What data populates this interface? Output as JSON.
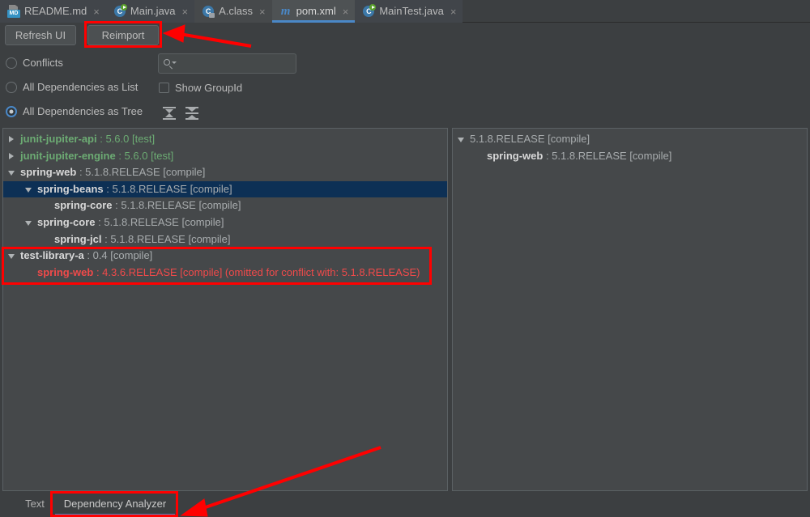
{
  "editor_tabs": [
    {
      "label": "README.md",
      "icon": "markdown-file-icon",
      "active": false,
      "close": "×"
    },
    {
      "label": "Main.java",
      "icon": "java-class-run-icon",
      "active": false,
      "close": "×"
    },
    {
      "label": "A.class",
      "icon": "java-compiled-class-icon",
      "active": false,
      "close": "×"
    },
    {
      "label": "pom.xml",
      "icon": "maven-file-icon",
      "active": true,
      "close": "×"
    },
    {
      "label": "MainTest.java",
      "icon": "java-test-class-icon",
      "active": false,
      "close": "×"
    }
  ],
  "toolbar": {
    "refresh_label": "Refresh UI",
    "reimport_label": "Reimport"
  },
  "options": {
    "conflicts_label": "Conflicts",
    "all_as_list_label": "All Dependencies as List",
    "all_as_tree_label": "All Dependencies as Tree",
    "show_groupid_label": "Show GroupId",
    "selected": "All Dependencies as Tree",
    "show_groupid_checked": false,
    "expand_all_icon": "expand-all-icon",
    "collapse_all_icon": "collapse-all-icon"
  },
  "search": {
    "value": "",
    "placeholder": "",
    "icon": "search-icon"
  },
  "left_tree": {
    "rows": [
      {
        "indent": 0,
        "toggle": "right",
        "name": "junit-jupiter-api",
        "sep": " : ",
        "version": "5.6.0",
        "scope": " [test]",
        "style": "test"
      },
      {
        "indent": 0,
        "toggle": "right",
        "name": "junit-jupiter-engine",
        "sep": " : ",
        "version": "5.6.0",
        "scope": " [test]",
        "style": "test"
      },
      {
        "indent": 0,
        "toggle": "down",
        "name": "spring-web",
        "sep": " : ",
        "version": "5.1.8.RELEASE",
        "scope": " [compile]",
        "style": "normal"
      },
      {
        "indent": 1,
        "toggle": "down",
        "name": "spring-beans",
        "sep": " : ",
        "version": "5.1.8.RELEASE",
        "scope": " [compile]",
        "style": "normal",
        "selected": true
      },
      {
        "indent": 2,
        "toggle": "none",
        "name": "spring-core",
        "sep": " : ",
        "version": "5.1.8.RELEASE",
        "scope": " [compile]",
        "style": "normal"
      },
      {
        "indent": 1,
        "toggle": "down",
        "name": "spring-core",
        "sep": " : ",
        "version": "5.1.8.RELEASE",
        "scope": " [compile]",
        "style": "normal"
      },
      {
        "indent": 2,
        "toggle": "none",
        "name": "spring-jcl",
        "sep": " : ",
        "version": "5.1.8.RELEASE",
        "scope": " [compile]",
        "style": "normal"
      },
      {
        "indent": 0,
        "toggle": "down",
        "name": "test-library-a",
        "sep": " : ",
        "version": "0.4",
        "scope": " [compile]",
        "style": "normal"
      },
      {
        "indent": 1,
        "toggle": "none",
        "name": "spring-web",
        "sep": " : ",
        "version": "4.3.6.RELEASE",
        "scope": " [compile] (omitted for conflict with: 5.1.8.RELEASE)",
        "style": "conflict"
      }
    ]
  },
  "right_tree": {
    "rows": [
      {
        "indent": 0,
        "toggle": "down",
        "name": "",
        "sep": "",
        "version": "5.1.8.RELEASE",
        "scope": " [compile]",
        "style": "normal"
      },
      {
        "indent": 1,
        "toggle": "none",
        "name": "spring-web",
        "sep": " : ",
        "version": "5.1.8.RELEASE",
        "scope": " [compile]",
        "style": "normal"
      }
    ]
  },
  "bottom_tabs": {
    "text_label": "Text",
    "dependency_analyzer_label": "Dependency Analyzer",
    "active": "Dependency Analyzer"
  },
  "colors": {
    "accent": "#4a88c7",
    "selection": "#0d3055",
    "test_scope": "#6cab73",
    "conflict": "#f04a4a",
    "annotation": "#ff0000",
    "panel_bg": "#45484a",
    "window_bg": "#3c3f41"
  }
}
